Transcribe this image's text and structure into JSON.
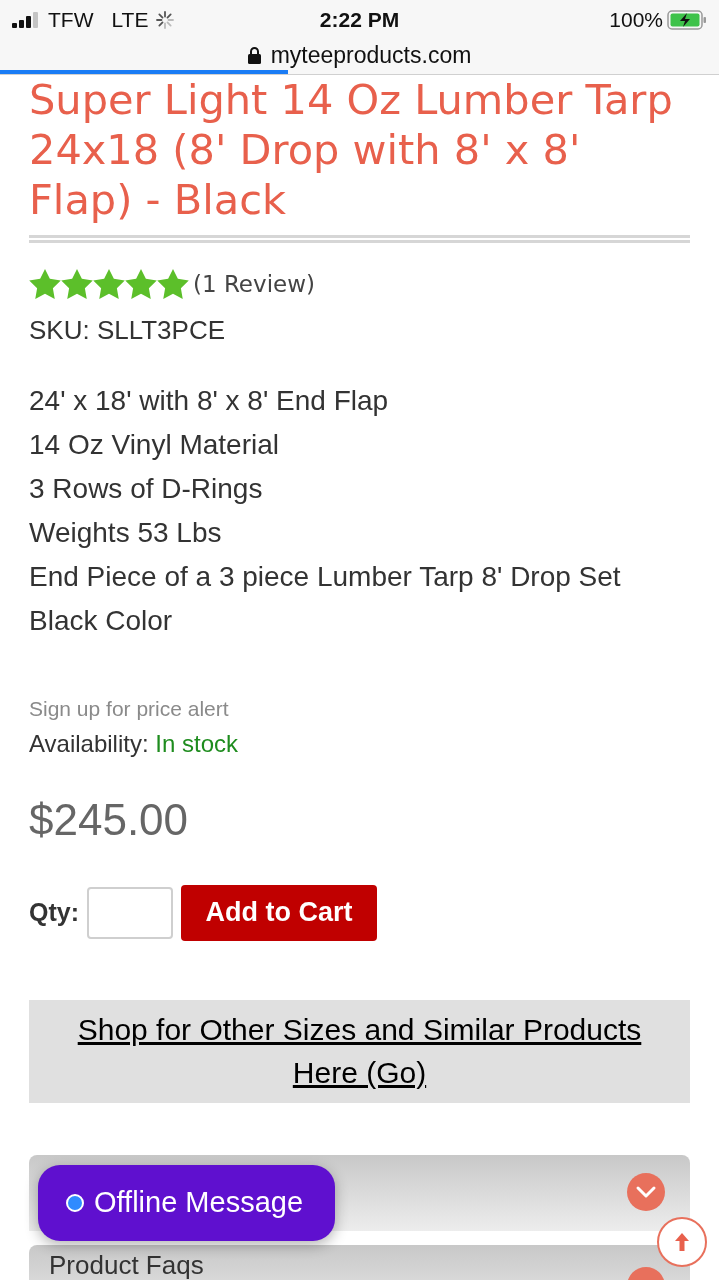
{
  "status_bar": {
    "carrier": "TFW",
    "network": "LTE",
    "time": "2:22 PM",
    "battery": "100%"
  },
  "address_bar": {
    "url": "myteeproducts.com",
    "progress": {
      "level": 0.4
    }
  },
  "product": {
    "title": "Super Light 14 Oz Lumber Tarp 24x18 (8' Drop with 8' x 8' Flap) - Black",
    "rating": {
      "stars": 5,
      "reviews": "(1 Review)"
    },
    "sku": "SKU: SLLT3PCE",
    "features": [
      "24' x 18' with 8' x 8' End Flap",
      "14 Oz Vinyl Material",
      "3 Rows of D-Rings",
      "Weights 53 Lbs",
      "End Piece of a 3 piece Lumber Tarp 8' Drop Set",
      "Black Color"
    ],
    "price_alert": "Sign up for price alert",
    "availability": {
      "label": "Availability:",
      "value": "In stock"
    },
    "price": "$245.00",
    "quantity": {
      "label": "Qty:"
    },
    "add_to_cart": "Add to Cart"
  },
  "similar_link": "Shop for Other Sizes and Similar Products Here (Go)",
  "sections": [
    {
      "expanded": false
    },
    {
      "title": "Product Faqs"
    }
  ],
  "chat_button": {
    "label": "Offline Message"
  }
}
